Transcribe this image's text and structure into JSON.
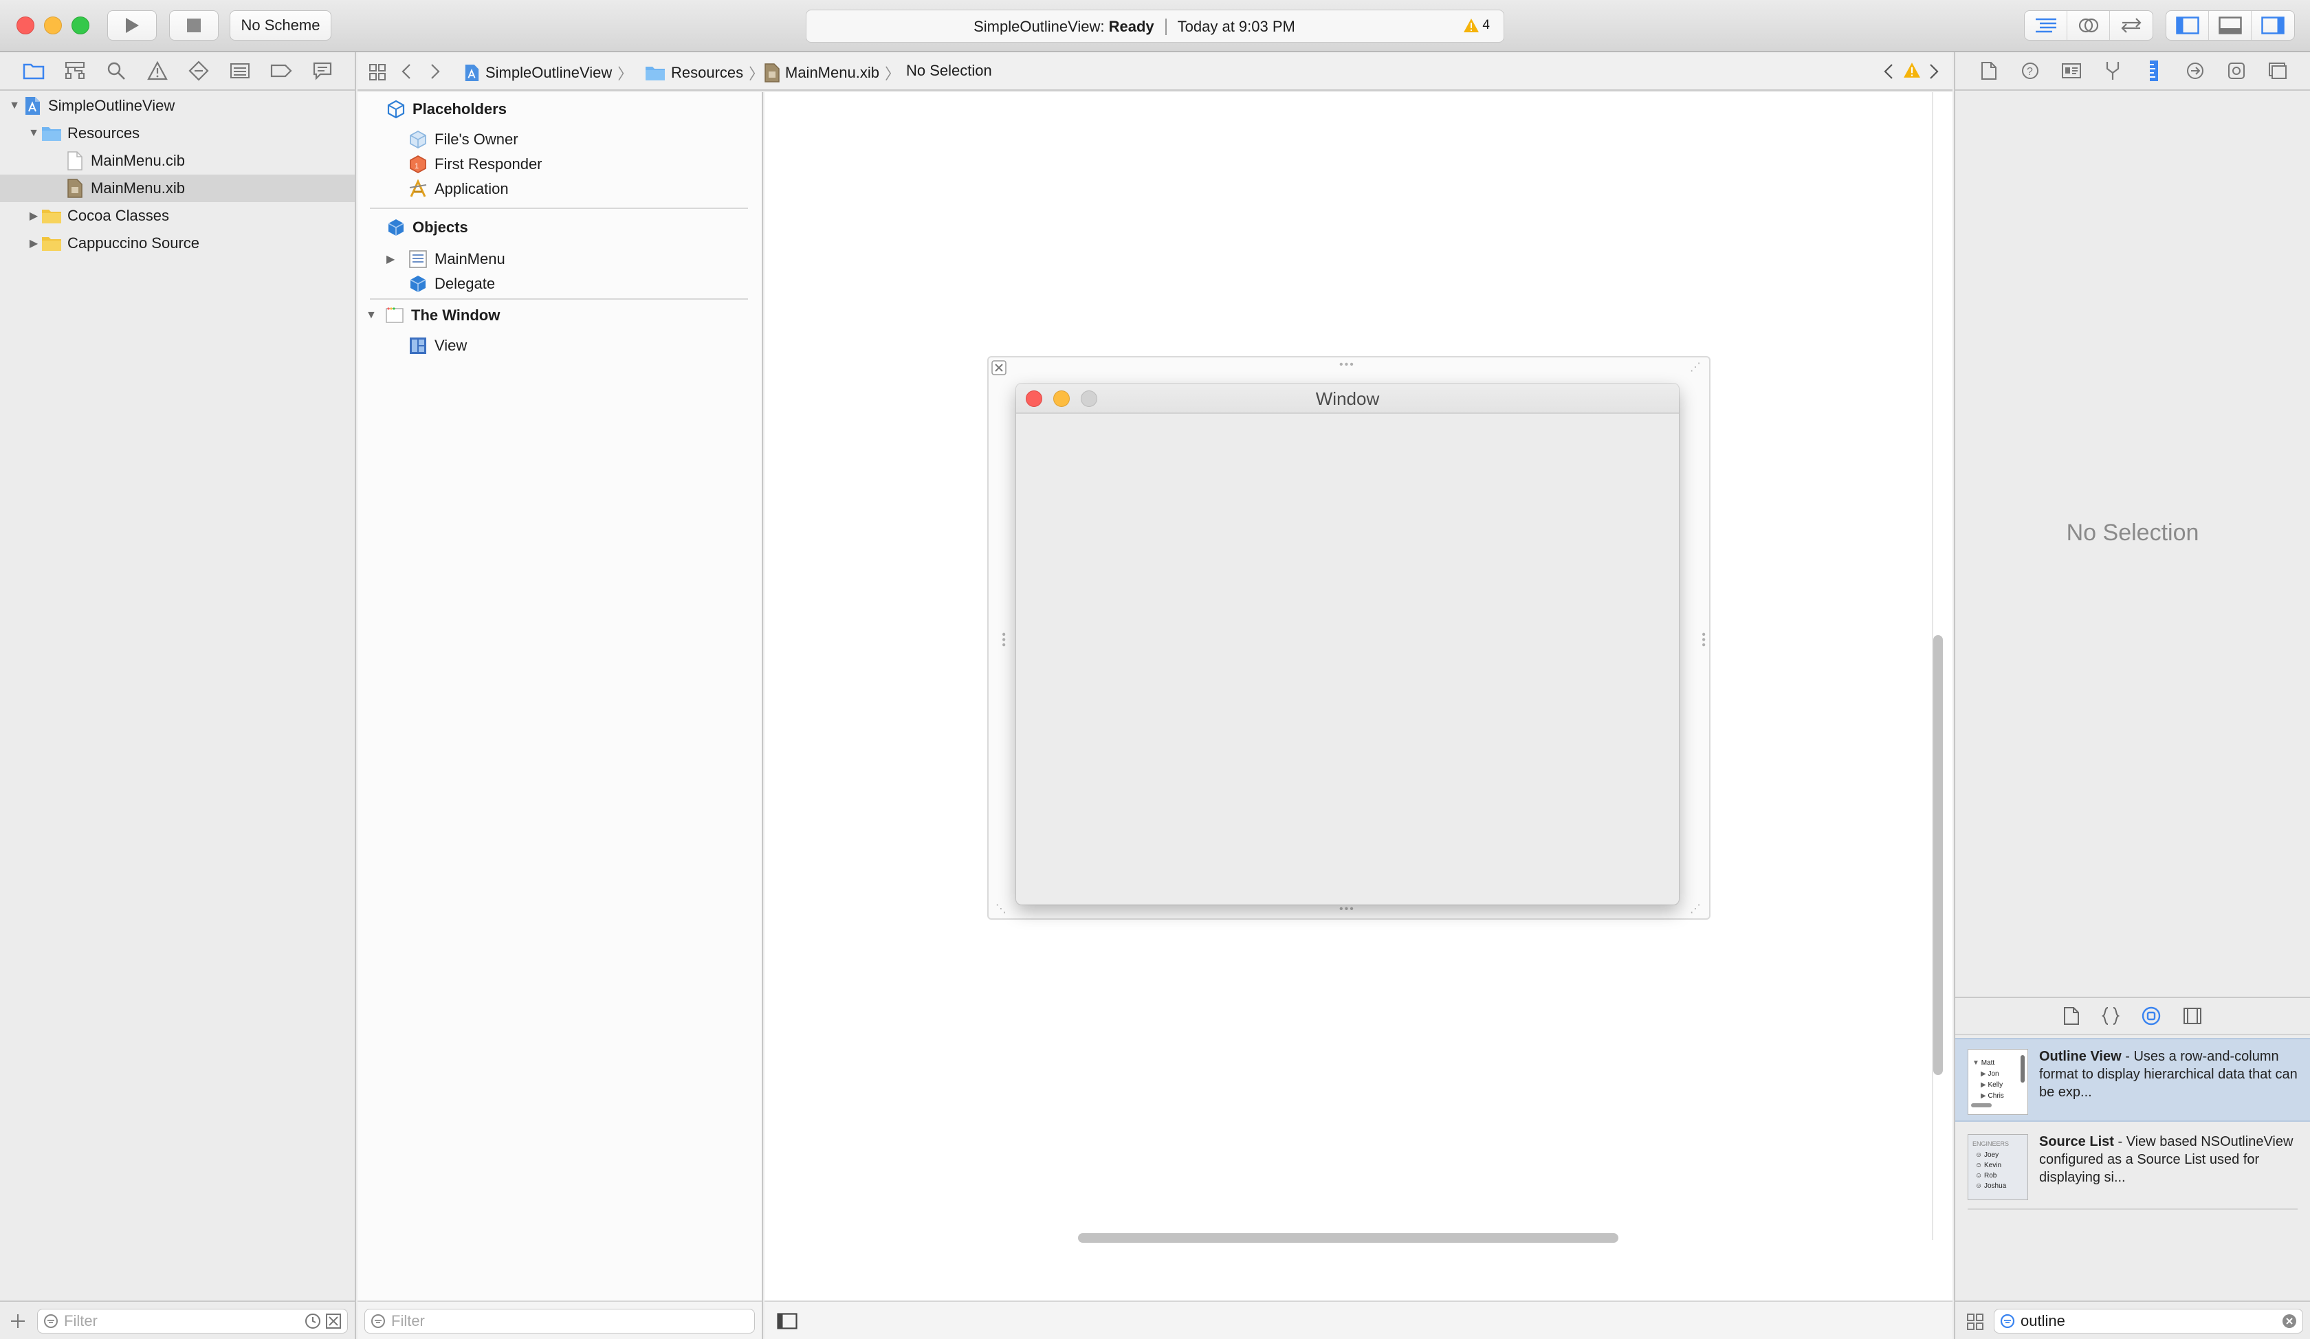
{
  "toolbar": {
    "scheme_label": "No Scheme",
    "activity_project": "SimpleOutlineView:",
    "activity_status": "Ready",
    "activity_time": "Today at 9:03 PM",
    "warning_count": "4"
  },
  "navigator": {
    "tree": [
      {
        "label": "SimpleOutlineView",
        "level": 0,
        "expanded": true,
        "icon": "project-icon"
      },
      {
        "label": "Resources",
        "level": 1,
        "expanded": true,
        "icon": "folder-blue-icon"
      },
      {
        "label": "MainMenu.cib",
        "level": 2,
        "icon": "file-icon"
      },
      {
        "label": "MainMenu.xib",
        "level": 2,
        "icon": "xib-file-icon",
        "selected": true
      },
      {
        "label": "Cocoa Classes",
        "level": 1,
        "expanded": false,
        "icon": "folder-yellow-icon"
      },
      {
        "label": "Cappuccino Source",
        "level": 1,
        "expanded": false,
        "icon": "folder-yellow-icon"
      }
    ],
    "filter_placeholder": "Filter"
  },
  "jumpbar": {
    "crumbs": [
      "SimpleOutlineView",
      "Resources",
      "MainMenu.xib",
      "No Selection"
    ]
  },
  "outline": {
    "placeholders_header": "Placeholders",
    "placeholders": [
      "File's Owner",
      "First Responder",
      "Application"
    ],
    "objects_header": "Objects",
    "objects": [
      "MainMenu",
      "Delegate"
    ],
    "window_header": "The Window",
    "window_children": [
      "View"
    ],
    "filter_placeholder": "Filter"
  },
  "canvas": {
    "window_title": "Window"
  },
  "inspector": {
    "no_selection": "No Selection"
  },
  "library": {
    "items": [
      {
        "title": "Outline View",
        "desc": " - Uses a row-and-column format to display hierarchical data that can be exp..."
      },
      {
        "title": "Source List",
        "desc": " - View based NSOutlineView configured as a Source List used for displaying si..."
      }
    ],
    "outline_thumb_rows": [
      "Matt",
      "Jon",
      "Kelly",
      "Chris"
    ],
    "source_thumb_header": "ENGINEERS",
    "source_thumb_rows": [
      "Joey",
      "Kevin",
      "Rob",
      "Joshua"
    ],
    "filter_value": "outline"
  },
  "colors": {
    "accent": "#3a84f0",
    "warning": "#f5b30a",
    "selection_bg": "#cbd9ea"
  }
}
